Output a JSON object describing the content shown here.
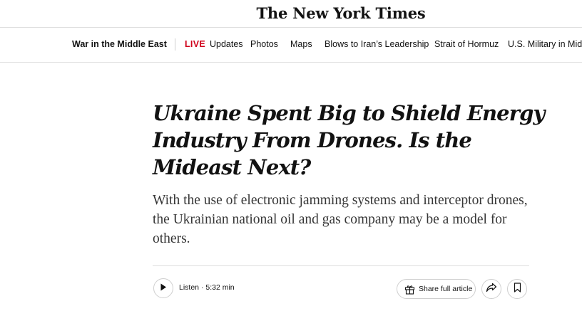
{
  "masthead": {
    "logo_text": "The New York Times"
  },
  "nav": {
    "section": "War in the Middle East",
    "live_badge": "LIVE",
    "items": [
      "Updates",
      "Photos",
      "Maps",
      "Blows to Iran’s Leadership",
      "Strait of Hormuz",
      "U.S. Military in Middle East"
    ]
  },
  "article": {
    "headline": "Ukraine Spent Big to Shield Energy Industry From Drones. Is the Mideast Next?",
    "summary": "With the use of electronic jamming systems and interceptor drones, the Ukrainian national oil and gas company may be a model for others."
  },
  "toolbar": {
    "listen_label": "Listen",
    "listen_separator": " · ",
    "listen_duration": "5:32 min",
    "share_full_label": "Share full article"
  },
  "icons": {
    "play": "play-icon",
    "gift": "gift-icon",
    "share": "share-arrow-icon",
    "bookmark": "bookmark-icon"
  },
  "colors": {
    "live_red": "#d0021b",
    "text": "#121212",
    "summary_text": "#363636",
    "divider": "#dfdfdf"
  }
}
